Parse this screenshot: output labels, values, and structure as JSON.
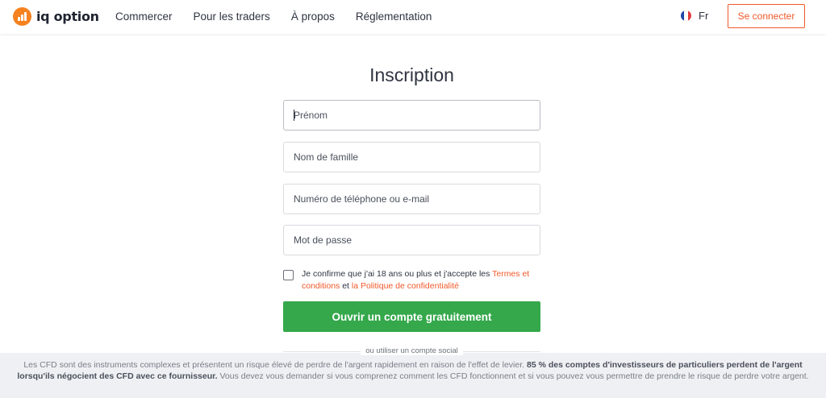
{
  "header": {
    "logo_text": "iq option",
    "nav": [
      "Commercer",
      "Pour les traders",
      "À propos",
      "Réglementation"
    ],
    "language": "Fr",
    "login_label": "Se connecter"
  },
  "form": {
    "title": "Inscription",
    "first_name_placeholder": "Prénom",
    "last_name_placeholder": "Nom de famille",
    "contact_placeholder": "Numéro de téléphone ou e-mail",
    "password_placeholder": "Mot de passe",
    "consent_prefix": "Je confirme que j'ai 18 ans ou plus et j'accepte les ",
    "terms_link": "Termes et conditions",
    "consent_and": " et ",
    "privacy_link": "la Politique de confidentialité",
    "submit_label": "Ouvrir un compte gratuitement",
    "social_text": "ou utiliser un compte social"
  },
  "risk": {
    "part1": "Les CFD sont des instruments complexes et présentent un risque élevé de perdre de l'argent rapidement en raison de l'effet de levier. ",
    "bold": "85 % des comptes d'investisseurs de particuliers perdent de l'argent lorsqu'ils négocient des CFD avec ce fournisseur.",
    "part2": " Vous devez vous demander si vous comprenez comment les CFD fonctionnent et si vous pouvez vous permettre de prendre le risque de perdre votre argent."
  },
  "colors": {
    "brand_orange": "#f6821f",
    "link_orange": "#f0592a",
    "submit_green": "#34a84b",
    "banner_bg": "#eef0f3"
  },
  "icons": {
    "logo": "iq-option-logo-icon",
    "flag": "france-flag-icon"
  }
}
